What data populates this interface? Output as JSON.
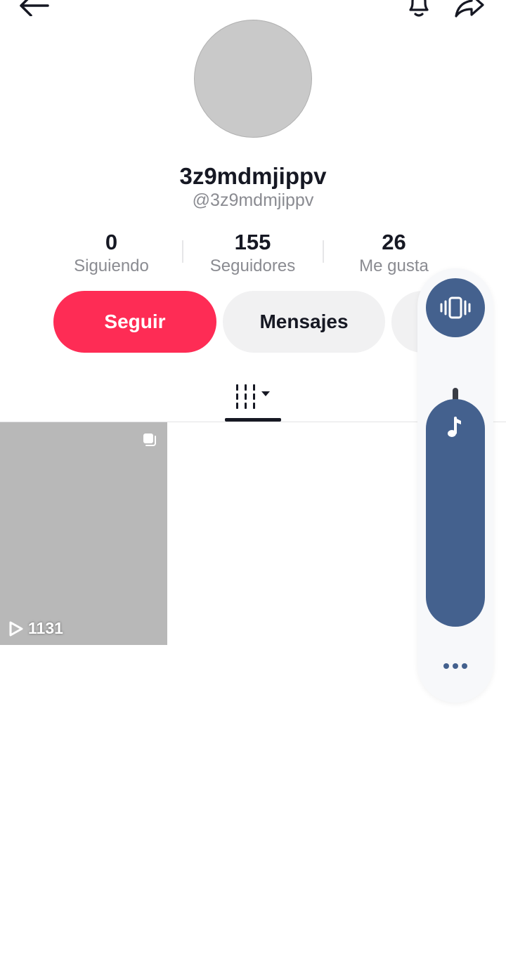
{
  "profile": {
    "display_name": "3z9mdmjippv",
    "handle": "@3z9mdmjippv"
  },
  "stats": [
    {
      "value": "0",
      "label": "Siguiendo"
    },
    {
      "value": "155",
      "label": "Seguidores"
    },
    {
      "value": "26",
      "label": "Me gusta"
    }
  ],
  "actions": {
    "follow_label": "Seguir",
    "messages_label": "Mensajes"
  },
  "videos": [
    {
      "views": "1131"
    }
  ],
  "icons": {
    "back": "arrow-left-icon",
    "notifications": "bell-icon",
    "share": "share-arrow-icon",
    "videos_tab": "grid-icon",
    "vibrate": "vibrate-icon",
    "music": "music-note-icon",
    "more": "more-dots-icon"
  },
  "colors": {
    "accent": "#fe2c55",
    "secondary_button": "#f1f1f2",
    "volume_control": "#44618e"
  }
}
